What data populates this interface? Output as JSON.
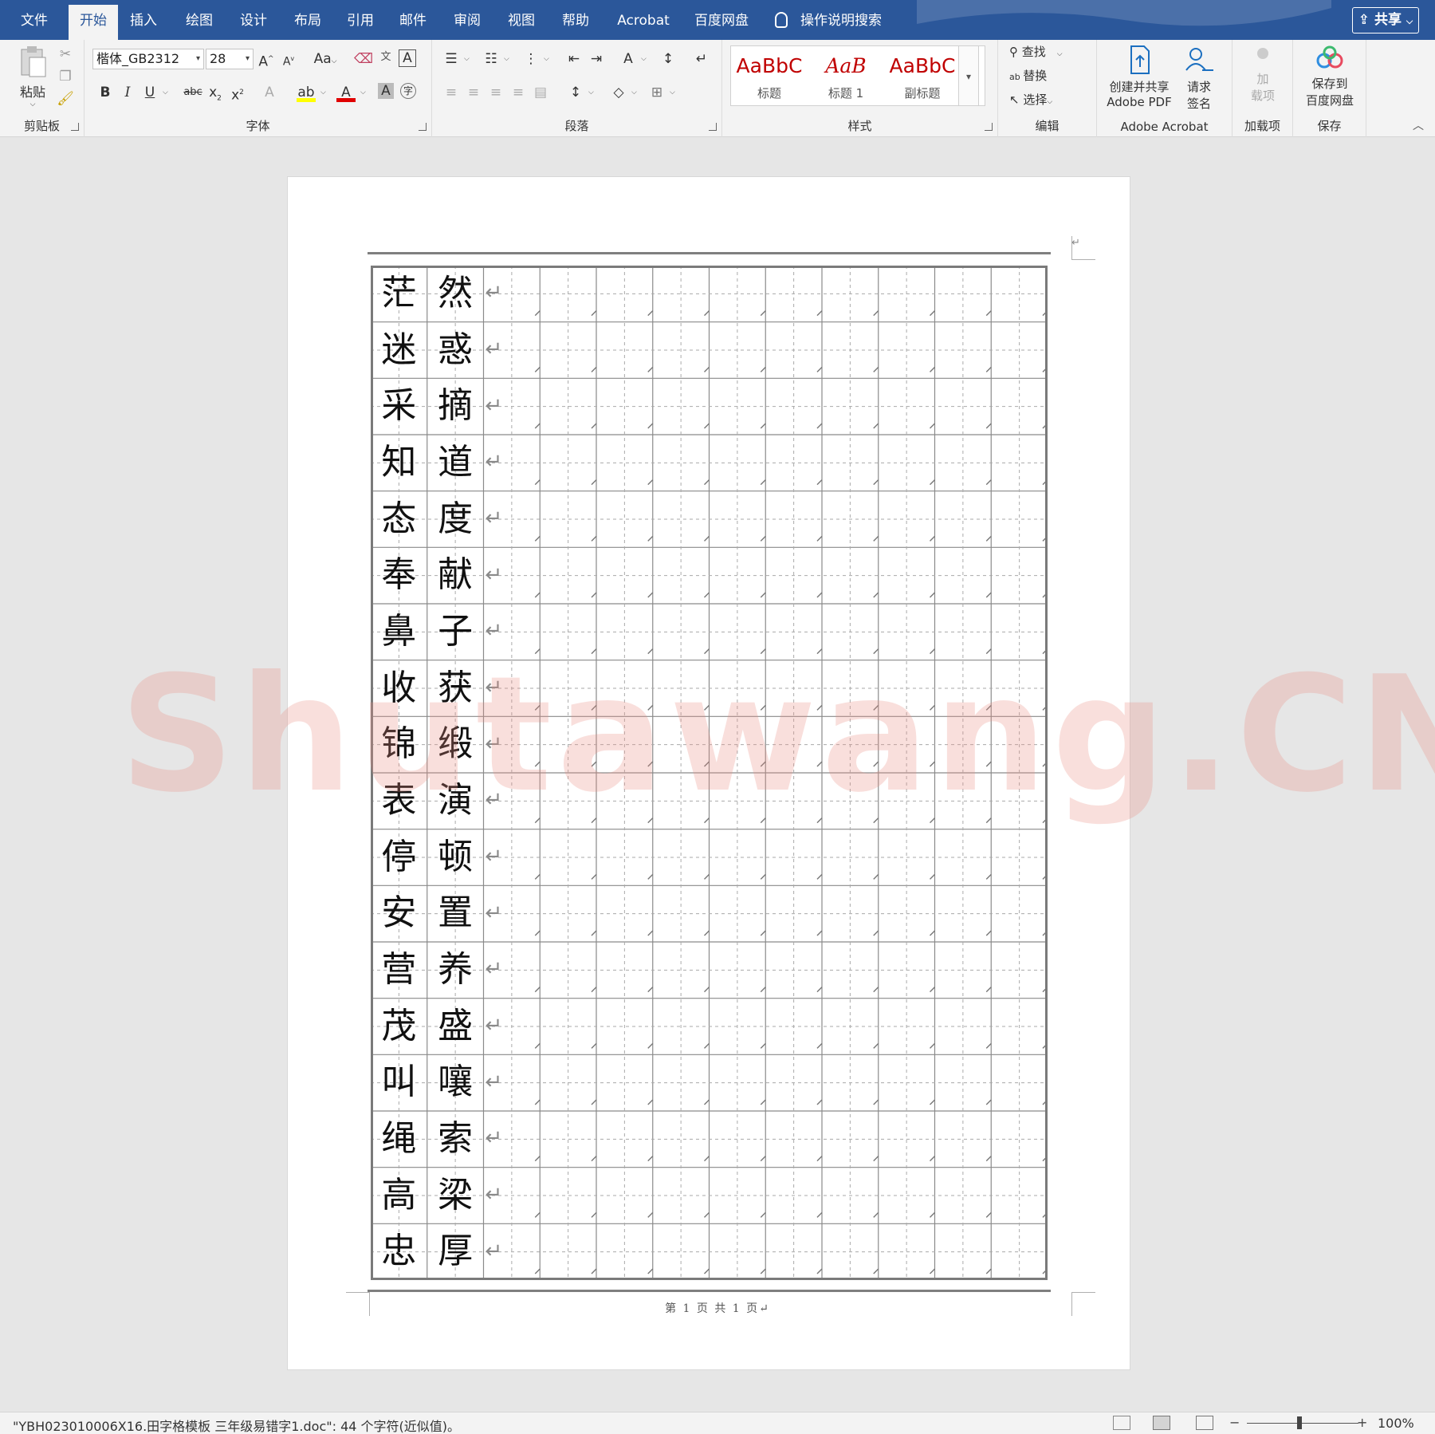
{
  "tabs": [
    {
      "label": "文件",
      "active": false
    },
    {
      "label": "开始",
      "active": true
    },
    {
      "label": "插入",
      "active": false
    },
    {
      "label": "绘图",
      "active": false
    },
    {
      "label": "设计",
      "active": false
    },
    {
      "label": "布局",
      "active": false
    },
    {
      "label": "引用",
      "active": false
    },
    {
      "label": "邮件",
      "active": false
    },
    {
      "label": "审阅",
      "active": false
    },
    {
      "label": "视图",
      "active": false
    },
    {
      "label": "帮助",
      "active": false
    },
    {
      "label": "Acrobat",
      "active": false
    },
    {
      "label": "百度网盘",
      "active": false
    }
  ],
  "tell_me": "操作说明搜索",
  "share": "共享",
  "ribbon": {
    "clipboard": {
      "label": "剪贴板",
      "paste": "粘贴"
    },
    "font": {
      "label": "字体",
      "font_name": "楷体_GB2312",
      "font_size": "28"
    },
    "paragraph": {
      "label": "段落"
    },
    "styles": {
      "label": "样式",
      "items": [
        {
          "sample": "AaBbC",
          "name": "标题"
        },
        {
          "sample": "AaB",
          "name": "标题 1"
        },
        {
          "sample": "AaBbC",
          "name": "副标题"
        }
      ]
    },
    "editing": {
      "label": "编辑",
      "find": "查找",
      "replace": "替换",
      "select": "选择"
    },
    "acrobat": {
      "label": "Adobe Acrobat",
      "create_line1": "创建并共享",
      "create_line2": "Adobe PDF",
      "sign_line1": "请求",
      "sign_line2": "签名"
    },
    "addins": {
      "label": "加载项",
      "btn_line1": "加",
      "btn_line2": "载项"
    },
    "save": {
      "label": "保存",
      "btn_line1": "保存到",
      "btn_line2": "百度网盘"
    }
  },
  "document": {
    "col1": [
      "茫",
      "迷",
      "采",
      "知",
      "态",
      "奉",
      "鼻",
      "收",
      "锦",
      "表",
      "停",
      "安",
      "营",
      "茂",
      "叫",
      "绳",
      "高",
      "忠"
    ],
    "col2": [
      "然",
      "惑",
      "摘",
      "道",
      "度",
      "献",
      "子",
      "获",
      "缎",
      "演",
      "顿",
      "置",
      "养",
      "盛",
      "嚷",
      "索",
      "梁",
      "厚"
    ],
    "footer": "第 1 页 共 1 页↵",
    "watermark": "Shutawang.CN"
  },
  "status": {
    "text": "\"YBH023010006X16.田字格模板 三年级易错字1.doc\": 44 个字符(近似值)。",
    "zoom": "100%"
  },
  "colors": {
    "accent": "#2b579a",
    "ribbon_bg": "#f3f3f3",
    "canvas_bg": "#e6e6e6",
    "style_red": "#c00000"
  }
}
